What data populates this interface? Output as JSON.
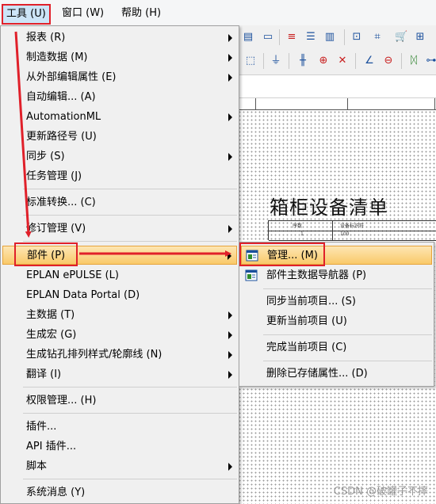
{
  "menubar": {
    "tools": "工具 (U)",
    "window": "窗口 (W)",
    "help": "帮助 (H)"
  },
  "drawing": {
    "title": "箱柜设备清单",
    "col1": "序数",
    "col2": "设备标识符",
    "row1": "1",
    "row1b": "100"
  },
  "tools_menu": {
    "items": [
      {
        "label": "报表 (R)"
      },
      {
        "label": "制造数据 (M)"
      },
      {
        "label": "从外部编辑属性 (E)"
      },
      {
        "label": "自动编辑... (A)"
      },
      {
        "label": "AutomationML"
      },
      {
        "label": "更新路径号 (U)"
      },
      {
        "label": "同步 (S)"
      },
      {
        "label": "任务管理 (J)"
      },
      {
        "label": "标准转换... (C)"
      },
      {
        "label": "修订管理 (V)"
      },
      {
        "label": "部件 (P)"
      },
      {
        "label": "EPLAN ePULSE (L)"
      },
      {
        "label": "EPLAN Data Portal (D)"
      },
      {
        "label": "主数据 (T)"
      },
      {
        "label": "生成宏 (G)"
      },
      {
        "label": "生成钻孔排列样式/轮廓线 (N)"
      },
      {
        "label": "翻译 (I)"
      },
      {
        "label": "权限管理... (H)"
      },
      {
        "label": "插件..."
      },
      {
        "label": "API 插件..."
      },
      {
        "label": "脚本"
      },
      {
        "label": "系统消息 (Y)"
      }
    ]
  },
  "parts_submenu": {
    "items": [
      {
        "label": "管理... (M)"
      },
      {
        "label": "部件主数据导航器 (P)"
      },
      {
        "label": "同步当前项目... (S)"
      },
      {
        "label": "更新当前项目 (U)"
      },
      {
        "label": "完成当前项目 (C)"
      },
      {
        "label": "删除已存储属性... (D)"
      }
    ]
  },
  "watermark": "CSDN @破罐子不摔",
  "colors": {
    "annotation": "#e0202a",
    "highlight": "#f9c96a",
    "menu_bg": "#f0f0f0"
  }
}
